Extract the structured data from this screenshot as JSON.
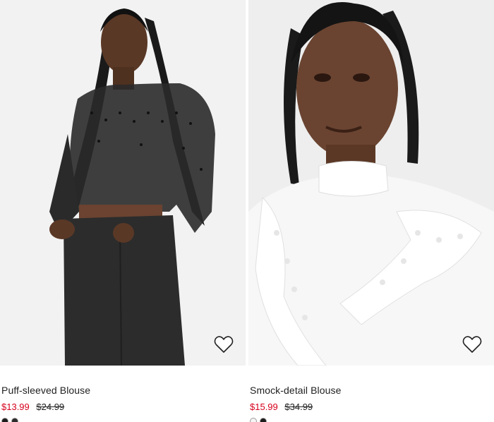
{
  "products": [
    {
      "title": "Puff-sleeved Blouse",
      "sale_price": "$13.99",
      "original_price": "$24.99",
      "image_alt": "Model wearing black sheer dotted puff-sleeved blouse with black jeans",
      "favorite_icon": "heart-outline-icon",
      "swatch_colors": [
        "#1c1c1c",
        "#2b2b2b"
      ]
    },
    {
      "title": "Smock-detail Blouse",
      "sale_price": "$15.99",
      "original_price": "$34.99",
      "image_alt": "Model wearing white eyelet-trimmed smock-detail blouse",
      "favorite_icon": "heart-outline-icon",
      "swatch_colors": [
        "#f5f5f5",
        "#1c1c1c"
      ]
    }
  ],
  "colors": {
    "sale": "#d6001c",
    "text": "#222222",
    "image_bg": "#f1f1f1"
  }
}
